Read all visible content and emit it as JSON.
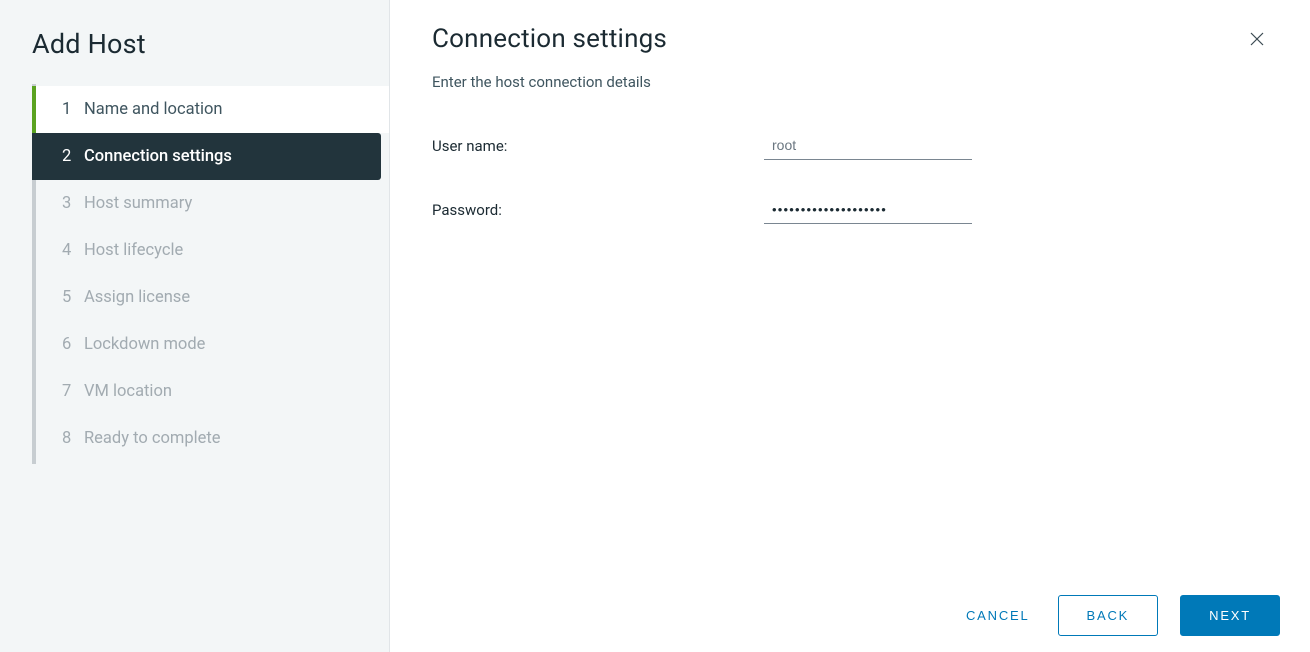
{
  "sidebar": {
    "title": "Add Host",
    "steps": [
      {
        "num": "1",
        "label": "Name and location",
        "state": "completed"
      },
      {
        "num": "2",
        "label": "Connection settings",
        "state": "active"
      },
      {
        "num": "3",
        "label": "Host summary",
        "state": "upcoming"
      },
      {
        "num": "4",
        "label": "Host lifecycle",
        "state": "upcoming"
      },
      {
        "num": "5",
        "label": "Assign license",
        "state": "upcoming"
      },
      {
        "num": "6",
        "label": "Lockdown mode",
        "state": "upcoming"
      },
      {
        "num": "7",
        "label": "VM location",
        "state": "upcoming"
      },
      {
        "num": "8",
        "label": "Ready to complete",
        "state": "upcoming"
      }
    ]
  },
  "content": {
    "title": "Connection settings",
    "subtitle": "Enter the host connection details",
    "form": {
      "username_label": "User name:",
      "username_value": "root",
      "password_label": "Password:",
      "password_value": "••••••••••••••••••••"
    }
  },
  "footer": {
    "cancel": "CANCEL",
    "back": "BACK",
    "next": "NEXT"
  }
}
